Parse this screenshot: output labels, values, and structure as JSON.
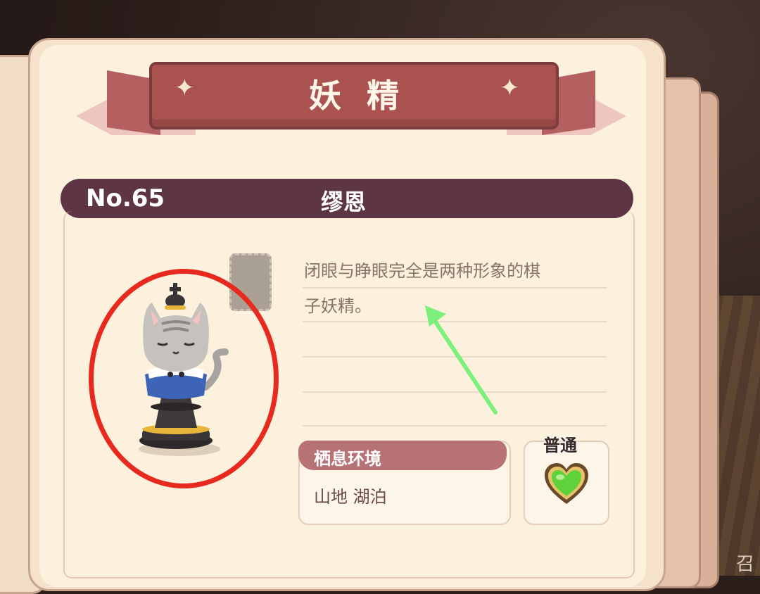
{
  "banner": {
    "title": "妖精"
  },
  "entry": {
    "number": "No.65",
    "name": "缪恩"
  },
  "description": {
    "line1": "闭眼与睁眼完全是两种形象的棋",
    "line2": "子妖精。"
  },
  "habitat": {
    "label": "栖息环境",
    "value": "山地 湖泊"
  },
  "rarity": {
    "label": "普通",
    "icon": "green-heart-icon"
  },
  "corner_text": "召",
  "colors": {
    "ribbon": "#a9524f",
    "header_bar": "#5e3545",
    "habitat_bar": "#b77276",
    "highlight_circle": "#e7291e",
    "arrow": "#7cf07a",
    "heart": "#5fd13a"
  }
}
